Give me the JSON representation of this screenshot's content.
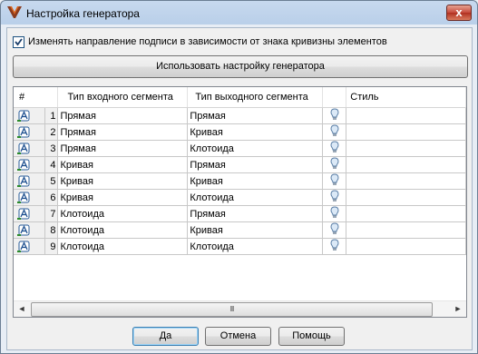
{
  "window": {
    "title": "Настройка генератора",
    "close_glyph": "x"
  },
  "options": {
    "change_direction_label": "Изменять направление подписи в зависимости от знака кривизны элементов",
    "change_direction_checked": true
  },
  "use_settings_button": "Использовать настройку генератора",
  "grid": {
    "columns": [
      "#",
      "Тип входного сегмента",
      "Тип выходного сегмента",
      "",
      "Стиль"
    ],
    "rows": [
      {
        "num": "1",
        "input": "Прямая",
        "output": "Прямая"
      },
      {
        "num": "2",
        "input": "Прямая",
        "output": "Кривая"
      },
      {
        "num": "3",
        "input": "Прямая",
        "output": "Клотоида"
      },
      {
        "num": "4",
        "input": "Кривая",
        "output": "Прямая"
      },
      {
        "num": "5",
        "input": "Кривая",
        "output": "Кривая"
      },
      {
        "num": "6",
        "input": "Кривая",
        "output": "Клотоида"
      },
      {
        "num": "7",
        "input": "Клотоида",
        "output": "Прямая"
      },
      {
        "num": "8",
        "input": "Клотоида",
        "output": "Кривая"
      },
      {
        "num": "9",
        "input": "Клотоида",
        "output": "Клотоида"
      }
    ],
    "row_icon": "text-label-icon",
    "style_icon": "lightbulb-icon",
    "scroll_left": "◄",
    "scroll_right": "►",
    "scroll_grip": "III"
  },
  "buttons": {
    "ok": "Да",
    "cancel": "Отмена",
    "help": "Помощь"
  },
  "colors": {
    "title_bar": "#b9cfe9",
    "close_button": "#c6493a",
    "dialog_bg": "#f0f0f0"
  }
}
